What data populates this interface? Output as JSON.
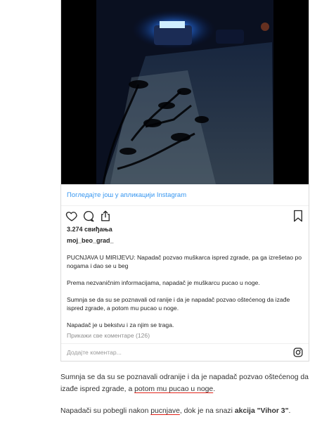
{
  "post": {
    "view_more": "Погледајте још у апликацији Instagram",
    "likes": "3.274 свиђања",
    "username": "moj_beo_grad_",
    "caption": [
      "PUCNJAVA U MIRIJEVU: Napadač pozvao muškarca ispred zgrade, pa ga izrešetao po nogama i dao se u beg",
      "Prema nezvaničnim informacijama, napadač je muškarcu pucao u noge.",
      "Sumnja se da su se poznavali od ranije i da je napadač pozvao oštećenog da izađe ispred zgrade, a potom mu pucao u noge.",
      "Napadač je u bekstvu i za njim se traga."
    ],
    "view_comments": "Прикажи све коментаре (126)",
    "add_comment_placeholder": "Додајте коментар...",
    "icons": [
      "heart-icon",
      "comment-icon",
      "share-icon",
      "bookmark-icon",
      "instagram-icon"
    ]
  },
  "article": {
    "p1_a": "Sumnja se da su se poznavali odranije i da je napadač pozvao oštećenog da izađe ispred zgrade, a ",
    "p1_link": "potom mu pucao u noge",
    "p1_end": ".",
    "p2_a": "Napadači su pobegli nakon ",
    "p2_link": "pucnjave",
    "p2_b": ", dok je na snazi ",
    "p2_bold": "akcija \"Vihor 3\"",
    "p2_end": ".",
    "link_underline_color": "#e2231a"
  }
}
